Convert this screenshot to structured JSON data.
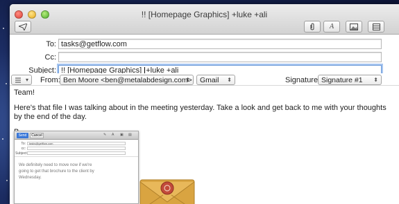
{
  "window": {
    "title": "!! [Homepage Graphics] +luke +ali"
  },
  "toolbar": {
    "send_icon": "paper-plane-icon",
    "attach_icon": "paperclip-icon",
    "format_icon": "font-A-icon",
    "photo_icon": "photo-browser-icon",
    "template_icon": "stationery-icon"
  },
  "headers": {
    "to_label": "To:",
    "to_value": "tasks@getflow.com",
    "cc_label": "Cc:",
    "cc_value": "",
    "subject_label": "Subject:",
    "subject_value_before": "!! [Homepage Graphics] ",
    "subject_value_after": "+luke +ali",
    "from_label": "From:",
    "from_value": "Ben Moore <ben@metalabdesign.com>",
    "account_value": "Gmail",
    "signature_label": "Signature:",
    "signature_value": "Signature #1"
  },
  "body": {
    "greeting": "Team!",
    "message": "Here's that file I was talking about in the meeting yesterday. Take a look and get back to me with your thoughts by the end of the day.",
    "signoff": "B."
  },
  "attachment_preview": {
    "send_label": "Send",
    "cancel_label": "Cancel",
    "to_label": "To:",
    "to_value": "tasks@getflow.com",
    "cc_label": "cc:",
    "subject_label": "Subject:",
    "text": "We definitely need to move now if we're going to get that brochure to the client by Wednesday."
  },
  "colors": {
    "focus": "#6a9ad9",
    "send_blue": "#3b78d8",
    "envelope": "#d9a441"
  }
}
